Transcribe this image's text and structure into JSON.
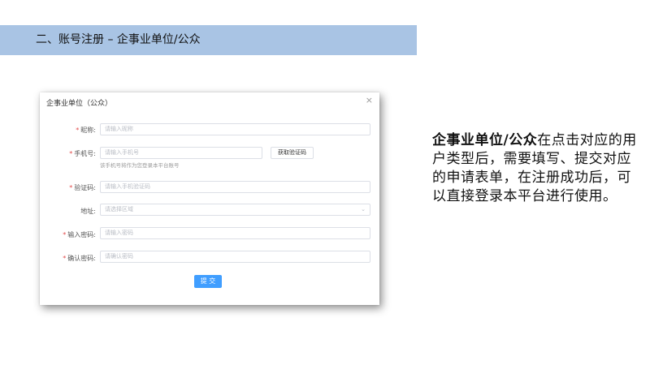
{
  "header": {
    "title": "二、账号注册 – 企事业单位/公众"
  },
  "dialog": {
    "title": "企事业单位（公众）",
    "close_icon": "×",
    "fields": {
      "nickname": {
        "label": "昵称:",
        "placeholder": "请输入昵称",
        "required": true
      },
      "phone": {
        "label": "手机号:",
        "placeholder": "请输入手机号",
        "required": true,
        "hint": "该手机号将作为您登录本平台账号"
      },
      "get_code_button": "获取验证码",
      "code": {
        "label": "验证码:",
        "placeholder": "请输入手机验证码",
        "required": true
      },
      "address": {
        "label": "地址:",
        "placeholder": "请选择区域",
        "required": false
      },
      "password": {
        "label": "输入密码:",
        "placeholder": "请输入密码",
        "required": true
      },
      "confirm": {
        "label": "确认密码:",
        "placeholder": "请确认密码",
        "required": true
      }
    },
    "required_mark": "*",
    "submit_label": "提 交"
  },
  "description": {
    "bold": "企事业单位/公众",
    "text": "在点击对应的用户类型后，需要填写、提交对应的申请表单，在注册成功后，可以直接登录本平台进行使用。"
  },
  "colors": {
    "header_bar": "#a9c4e4",
    "primary": "#409eff",
    "required": "#e34b4b"
  }
}
